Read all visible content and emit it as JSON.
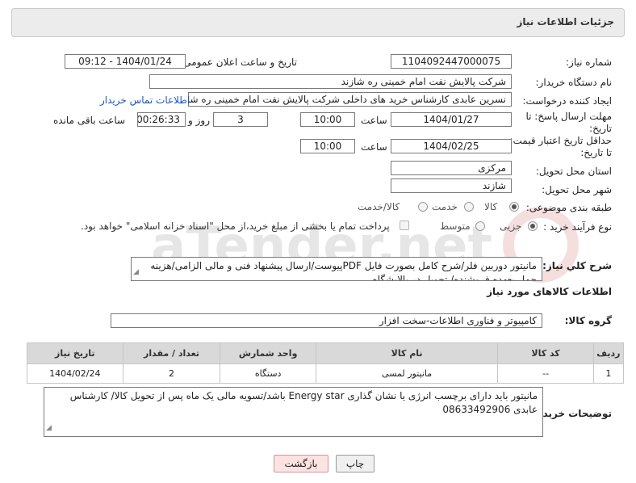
{
  "header": {
    "title": "جزئیات اطلاعات نیاز"
  },
  "need_number": {
    "label": "شماره نیاز:",
    "value": "1104092447000075"
  },
  "announce": {
    "label": "تاریخ و ساعت اعلان عمومی:",
    "value": "1404/01/24 - 09:12"
  },
  "buyer_org": {
    "label": "نام دستگاه خریدار:",
    "value": "شرکت پالایش نفت امام خمینی  ره  شازند"
  },
  "creator": {
    "label": "ایجاد کننده درخواست:",
    "value": "نسرین عابدی کارشناس خرید های داخلی  شرکت پالایش نفت امام خمینی  ره  شازند",
    "contact_link": "اطلاعات تماس خریدار"
  },
  "deadline": {
    "label_line1": "مهلت ارسال پاسخ: تا",
    "label_line2": "تاریخ:",
    "date": "1404/01/27",
    "time_label": "ساعت",
    "time": "10:00",
    "days": "3",
    "days_label": "روز و",
    "remaining": "00:26:33",
    "remaining_label": "ساعت باقی مانده"
  },
  "validity": {
    "label_line1": "حداقل تاریخ اعتبار قیمت:",
    "label_line2": "تا تاریخ:",
    "date": "1404/02/25",
    "time_label": "ساعت",
    "time": "10:00"
  },
  "province": {
    "label": "استان محل تحویل:",
    "value": "مرکزی"
  },
  "city": {
    "label": "شهر محل تحویل:",
    "value": "شازند"
  },
  "category": {
    "label": "طبقه بندی موضوعی:",
    "options": [
      "کالا",
      "خدمت",
      "کالا/خدمت"
    ],
    "selected": "کالا"
  },
  "process": {
    "label": "نوع فرآیند خرید :",
    "options": [
      "جزیی",
      "متوسط"
    ],
    "selected": "جزیی",
    "payment_note": "پرداخت تمام یا بخشی از مبلغ خرید،از محل \"اسناد خزانه اسلامی\" خواهد بود."
  },
  "description": {
    "label": "شرح کلي نياز:",
    "value": "مانیتور دوربین فلر/شرح کامل بصورت فایل PDFپیوست/ارسال پیشنهاد فنی و مالی الزامی/هزینه حمل بعهده فروشنده/ تحویل در پالایشگاه"
  },
  "goods_info": {
    "title": "اطلاعات کالاهای مورد نیاز"
  },
  "goods_group": {
    "label": "گروه کالا:",
    "value": "کامپیوتر و فناوری اطلاعات-سخت افزار"
  },
  "table": {
    "headers": [
      "ردیف",
      "کد کالا",
      "نام کالا",
      "واحد شمارش",
      "تعداد / مقدار",
      "تاریخ نیاز"
    ],
    "rows": [
      [
        "1",
        "--",
        "مانیتور لمسی",
        "دستگاه",
        "2",
        "1404/02/24"
      ]
    ]
  },
  "buyer_notes": {
    "label": "توضیحات خریدار:",
    "value": "مانیتور باید دارای برچسب انرژی یا نشان گذاری Energy star باشد/تسویه مالی یک ماه پس از تحویل کالا/ کارشناس عابدی 08633492906"
  },
  "buttons": {
    "print": "چاپ",
    "back": "بازگشت"
  },
  "watermark": {
    "text": "AriaTender.net"
  }
}
